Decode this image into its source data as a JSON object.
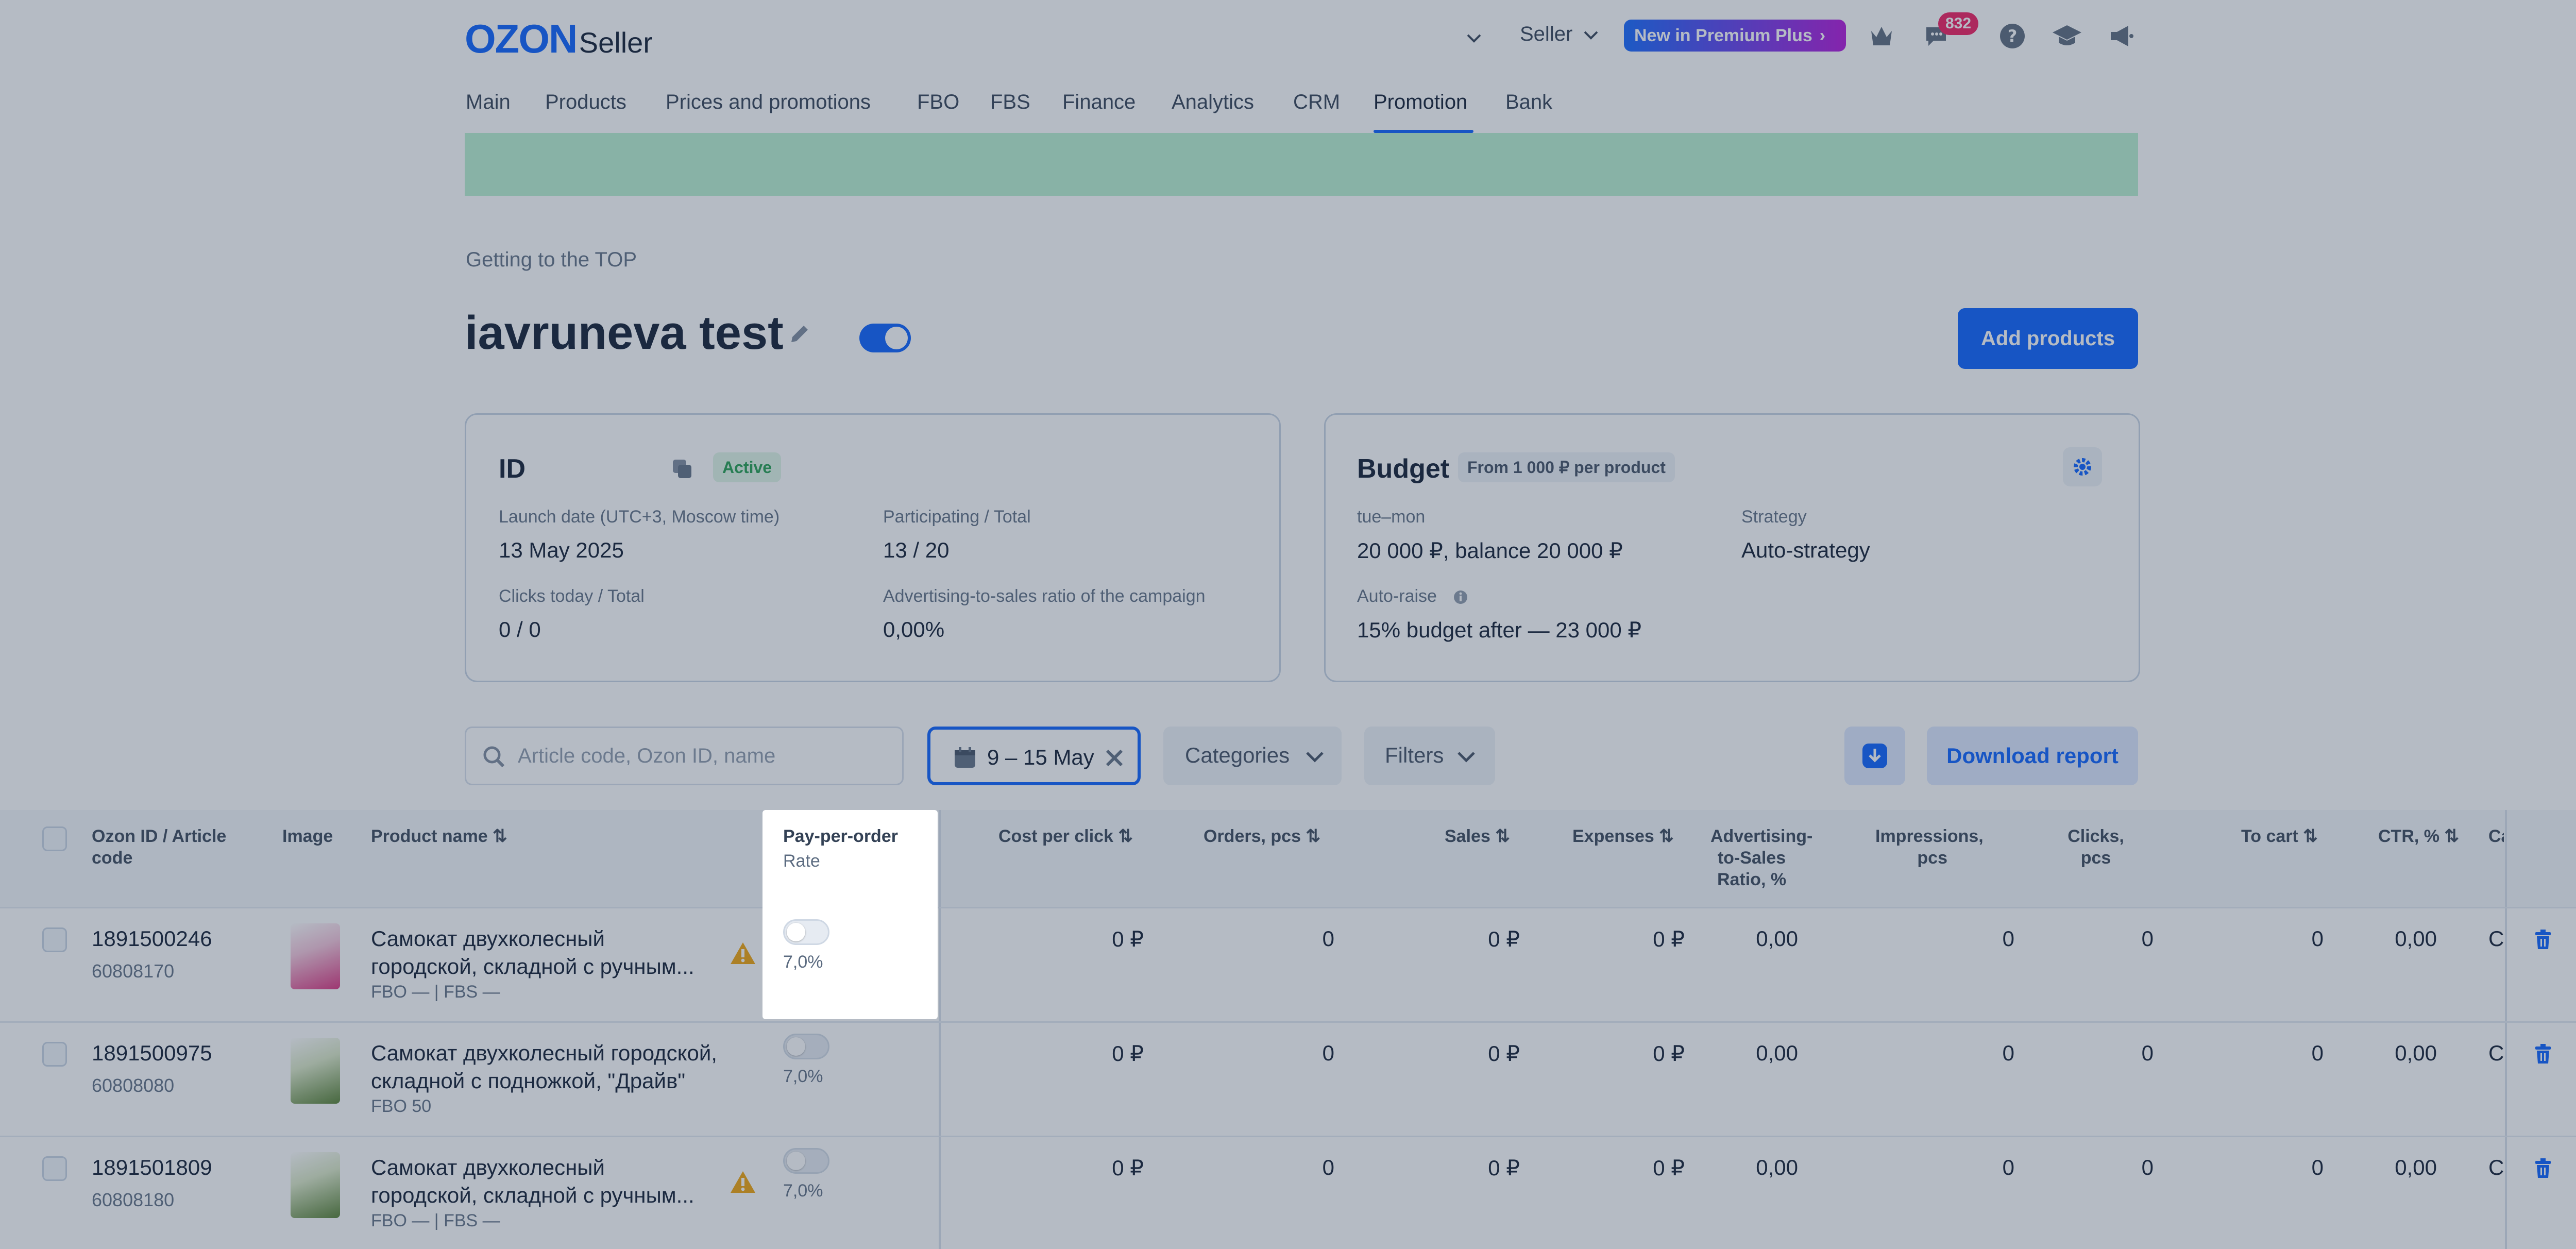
{
  "header": {
    "logo_brand": "OZON",
    "logo_suffix": "Seller",
    "seller_label": "Seller",
    "premium_label": "New in Premium Plus",
    "chat_badge": "832",
    "icons": [
      "crown-icon",
      "chat-icon",
      "help-icon",
      "education-icon",
      "announcement-icon"
    ]
  },
  "nav": {
    "items": [
      "Main",
      "Products",
      "Prices and promotions",
      "FBO",
      "FBS",
      "Finance",
      "Analytics",
      "CRM",
      "Promotion",
      "Bank"
    ],
    "active": "Promotion"
  },
  "page": {
    "breadcrumb": "Getting to the TOP",
    "title": "iavruneva test",
    "add_products_label": "Add products"
  },
  "campaign": {
    "id_label": "ID",
    "status": "Active",
    "launch_label": "Launch date (UTC+3, Moscow time)",
    "launch_value": "13 May 2025",
    "participating_label": "Participating / Total",
    "participating_value": "13 / 20",
    "clicks_label": "Clicks today / Total",
    "clicks_value": "0 / 0",
    "ratio_label": "Advertising-to-sales ratio of the campaign",
    "ratio_value": "0,00%"
  },
  "budget": {
    "title": "Budget",
    "badge": "From 1 000 ₽ per product",
    "period_label": "tue–mon",
    "period_value": "20 000 ₽, balance 20 000 ₽",
    "strategy_label": "Strategy",
    "strategy_value": "Auto-strategy",
    "autoraise_label": "Auto-raise",
    "autoraise_value": "15% budget after — 23 000 ₽"
  },
  "filters": {
    "search_placeholder": "Article code, Ozon ID, name",
    "date_range": "9 – 15 May",
    "categories_label": "Categories",
    "filters_label": "Filters",
    "download_label": "Download report"
  },
  "table": {
    "headers": {
      "id": "Ozon ID / Article code",
      "image": "Image",
      "name": "Product name",
      "ppo_title": "Pay-per-order",
      "ppo_sub": "Rate",
      "cpc": "Cost per click",
      "orders": "Orders, pcs",
      "sales": "Sales",
      "expenses": "Expenses",
      "drr": "Advertising-to-Sales Ratio, %",
      "impressions": "Impressions, pcs",
      "clicks": "Clicks, pcs",
      "cart": "To cart",
      "ctr": "CTR, %",
      "cut": "Ca"
    },
    "rows": [
      {
        "ozon_id": "1891500246",
        "article": "60808170",
        "name_line1": "Самокат двухколесный",
        "name_line2": "городской, складной с ручным...",
        "stock": "FBO — | FBS —",
        "warning": true,
        "rate": "7,0%",
        "cpc": "0 ₽",
        "orders": "0",
        "sales": "0 ₽",
        "expenses": "0 ₽",
        "drr": "0,00",
        "impressions": "0",
        "clicks": "0",
        "cart": "0",
        "ctr": "0,00",
        "cut": "Cl",
        "thumb_color": "#d92b7a"
      },
      {
        "ozon_id": "1891500975",
        "article": "60808080",
        "name_line1": "Самокат двухколесный городской,",
        "name_line2": "складной с подножкой, \"Драйв\"",
        "stock": "FBO 50",
        "warning": false,
        "rate": "7,0%",
        "cpc": "0 ₽",
        "orders": "0",
        "sales": "0 ₽",
        "expenses": "0 ₽",
        "drr": "0,00",
        "impressions": "0",
        "clicks": "0",
        "cart": "0",
        "ctr": "0,00",
        "cut": "Cl",
        "thumb_color": "#4f7a2a"
      },
      {
        "ozon_id": "1891501809",
        "article": "60808180",
        "name_line1": "Самокат двухколесный",
        "name_line2": "городской, складной с ручным...",
        "stock": "FBO — | FBS —",
        "warning": true,
        "rate": "7,0%",
        "cpc": "0 ₽",
        "orders": "0",
        "sales": "0 ₽",
        "expenses": "0 ₽",
        "drr": "0,00",
        "impressions": "0",
        "clicks": "0",
        "cart": "0",
        "ctr": "0,00",
        "cut": "Cl",
        "thumb_color": "#4f7a2a"
      }
    ]
  },
  "colors": {
    "accent": "#005bff",
    "active_badge_bg": "#dff5e6",
    "active_badge_text": "#1a9c4a",
    "banner": "#b7f0cf",
    "premium_start": "#0b62ff",
    "premium_end": "#b10dd9",
    "warning": "#f0a000",
    "chat_badge": "#f0145a"
  }
}
